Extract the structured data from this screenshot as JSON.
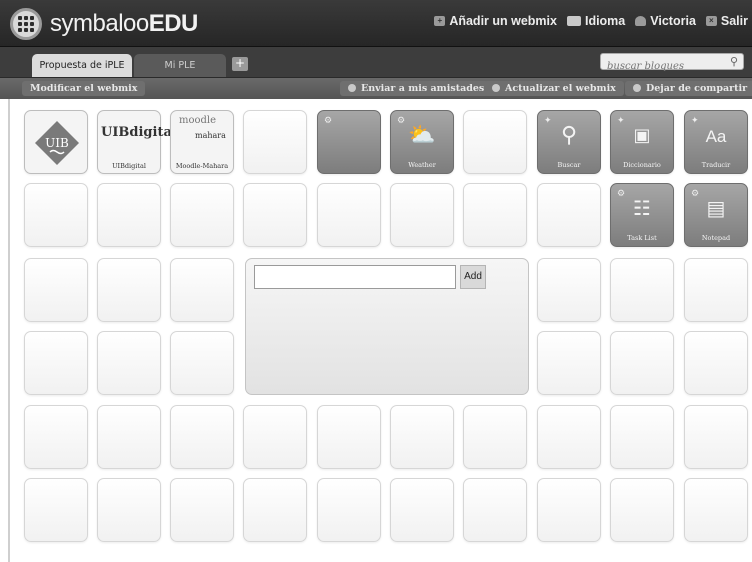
{
  "header": {
    "logo_symbaloo": "symbaloo",
    "logo_edu": "EDU",
    "actions": [
      {
        "label": "Añadir un webmix",
        "icon": "plus-icon"
      },
      {
        "label": "Idioma",
        "icon": "flag-icon"
      },
      {
        "label": "Victoria",
        "icon": "user-icon"
      },
      {
        "label": "Salir",
        "icon": "close-icon"
      }
    ]
  },
  "tabs": {
    "items": [
      {
        "label": "Propuesta de iPLE",
        "active": true
      },
      {
        "label": "Mi PLE",
        "active": false
      }
    ],
    "add_label": "+"
  },
  "search": {
    "placeholder": "buscar bloques"
  },
  "toolbar": {
    "modify": "Modificar el webmix",
    "send": "Enviar a mis amistades",
    "update": "Actualizar el webmix",
    "stop_sharing": "Dejar de compartir"
  },
  "tiles": {
    "uib": "UIB",
    "uibdigital_logo": "UIBdigital",
    "uibdigital_label": "UIBdigital",
    "moodle_logo": "moodle",
    "mahara_logo": "mahara",
    "moodle_label": "Moodle-Mahara",
    "weather": "Weather",
    "buscar": "Buscar",
    "diccionario": "Diccionario",
    "traducir": "Traducir",
    "traducir_glyph": "Aa",
    "task_list": "Task List",
    "notepad": "Notepad"
  },
  "widget": {
    "add_label": "Add",
    "value": ""
  },
  "colors": {
    "header": "#2c2c2c",
    "dark_tile": "#8f8f8f",
    "tile_border": "#d6d6d6"
  }
}
